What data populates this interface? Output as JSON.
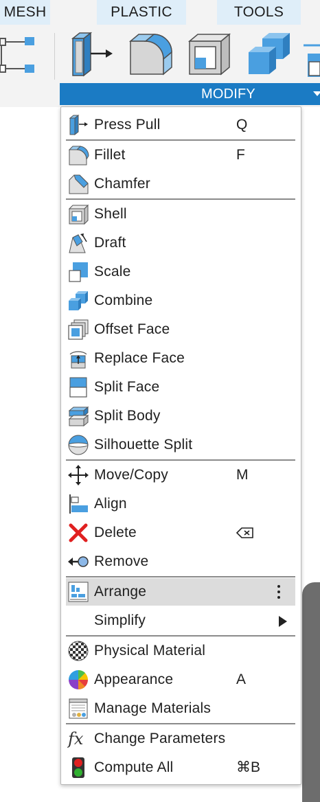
{
  "tabs": {
    "mesh": "MESH",
    "plastic": "PLASTIC",
    "tools": "TOOLS"
  },
  "modify_label": "MODIFY",
  "colors": {
    "accent": "#1b7bc4",
    "icon_blue": "#4a9fe0",
    "icon_gray": "#d4d4d4",
    "highlight": "#dcdcdc",
    "delete_red": "#e02020"
  },
  "menu": {
    "press_pull": {
      "label": "Press Pull",
      "shortcut": "Q",
      "icon": "press-pull-icon"
    },
    "fillet": {
      "label": "Fillet",
      "shortcut": "F",
      "icon": "fillet-icon"
    },
    "chamfer": {
      "label": "Chamfer",
      "icon": "chamfer-icon"
    },
    "shell": {
      "label": "Shell",
      "icon": "shell-icon"
    },
    "draft": {
      "label": "Draft",
      "icon": "draft-icon"
    },
    "scale": {
      "label": "Scale",
      "icon": "scale-icon"
    },
    "combine": {
      "label": "Combine",
      "icon": "combine-icon"
    },
    "offset_face": {
      "label": "Offset Face",
      "icon": "offset-face-icon"
    },
    "replace_face": {
      "label": "Replace Face",
      "icon": "replace-face-icon"
    },
    "split_face": {
      "label": "Split Face",
      "icon": "split-face-icon"
    },
    "split_body": {
      "label": "Split Body",
      "icon": "split-body-icon"
    },
    "silhouette_split": {
      "label": "Silhouette Split",
      "icon": "silhouette-split-icon"
    },
    "move_copy": {
      "label": "Move/Copy",
      "shortcut": "M",
      "icon": "move-copy-icon"
    },
    "align": {
      "label": "Align",
      "icon": "align-icon"
    },
    "delete": {
      "label": "Delete",
      "shortcut_icon": "delete-key-icon",
      "icon": "delete-icon"
    },
    "remove": {
      "label": "Remove",
      "icon": "remove-icon"
    },
    "arrange": {
      "label": "Arrange",
      "icon": "arrange-icon",
      "highlighted": true
    },
    "simplify": {
      "label": "Simplify",
      "has_submenu": true
    },
    "physical_material": {
      "label": "Physical Material",
      "icon": "physical-material-icon"
    },
    "appearance": {
      "label": "Appearance",
      "shortcut": "A",
      "icon": "appearance-icon"
    },
    "manage_materials": {
      "label": "Manage Materials",
      "icon": "manage-materials-icon"
    },
    "change_parameters": {
      "label": "Change Parameters",
      "icon": "fx-icon"
    },
    "compute_all": {
      "label": "Compute All",
      "shortcut": "⌘B",
      "icon": "traffic-light-icon"
    }
  }
}
